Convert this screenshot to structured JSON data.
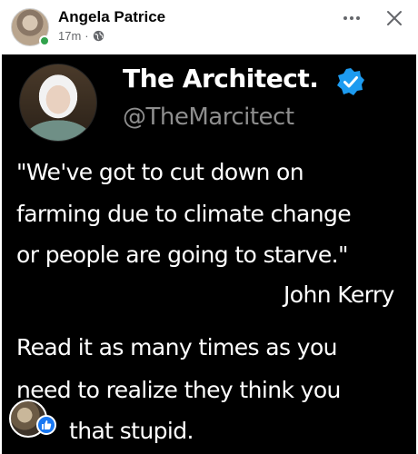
{
  "post": {
    "author_name": "Angela Patrice",
    "time_ago": "17m",
    "separator": "·",
    "privacy_icon": "globe-icon",
    "menu_icon": "more-horizontal-icon",
    "close_icon": "close-icon"
  },
  "tweet": {
    "display_name": "The Architect.",
    "handle": "@TheMarcitect",
    "verified_icon": "verified-badge-icon",
    "lines": [
      "\"We've got to cut down on",
      "farming due to climate change",
      "or people are going to starve.\"",
      "John Kerry",
      "Read it as many times as you",
      "need to realize they think you",
      "that stupid."
    ]
  },
  "reaction": {
    "icon": "like-icon"
  },
  "colors": {
    "verified_blue": "#1d9bf0",
    "facebook_blue": "#1877f2",
    "online_green": "#31a24c",
    "meta_gray": "#65676b"
  }
}
